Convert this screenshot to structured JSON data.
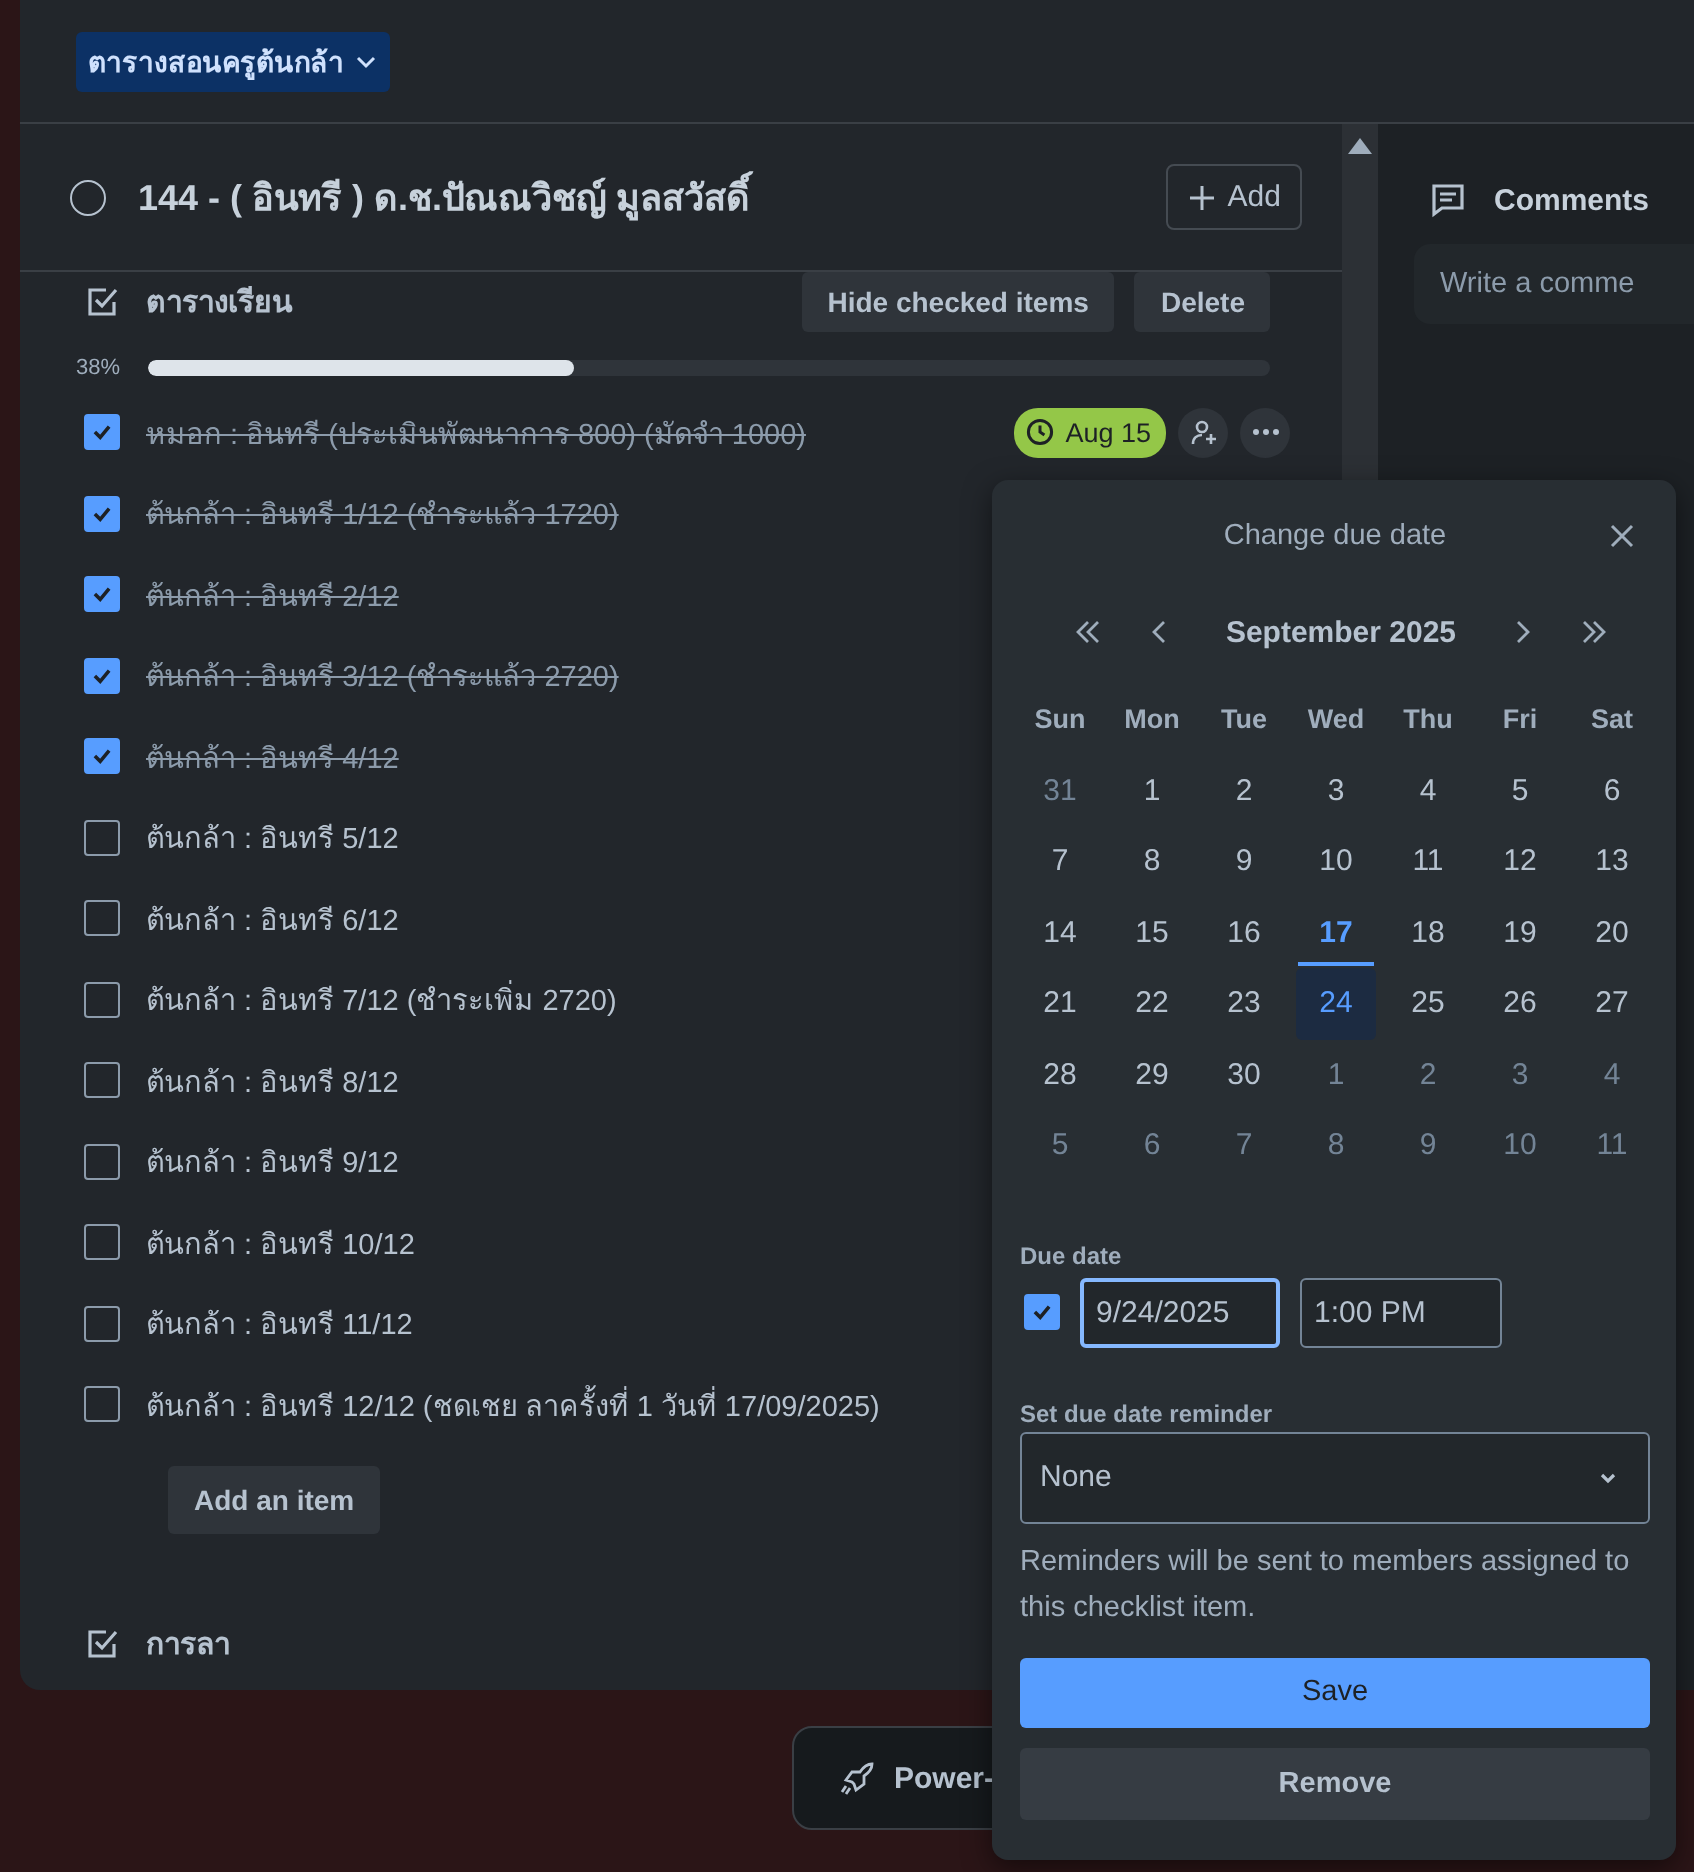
{
  "board_menu": {
    "label": "ตารางสอนครูต้นกล้า"
  },
  "card": {
    "title": "144 - ( อินทรี ) ด.ช.ปัณณวิชญ์ มูลสวัสดิ์",
    "completed": false,
    "add_button": "Add"
  },
  "checklists": [
    {
      "title": "ตารางเรียน",
      "hide_button": "Hide checked items",
      "delete_button": "Delete",
      "progress_label": "38%",
      "level": 0.38,
      "add_item_button": "Add an item",
      "items": [
        {
          "text": "หมอก : อินทรี (ประเมินพัฒนาการ 800) (มัดจำ 1000)",
          "checked": true,
          "due": "Aug 15"
        },
        {
          "text": "ต้นกล้า : อินทรี 1/12 (ชำระแล้ว 1720)",
          "checked": true
        },
        {
          "text": "ต้นกล้า : อินทรี 2/12",
          "checked": true
        },
        {
          "text": "ต้นกล้า : อินทรี 3/12 (ชำระแล้ว 2720)",
          "checked": true
        },
        {
          "text": "ต้นกล้า : อินทรี 4/12",
          "checked": true
        },
        {
          "text": "ต้นกล้า : อินทรี 5/12",
          "checked": false
        },
        {
          "text": "ต้นกล้า : อินทรี 6/12",
          "checked": false
        },
        {
          "text": "ต้นกล้า : อินทรี 7/12 (ชำระเพิ่ม 2720)",
          "checked": false
        },
        {
          "text": "ต้นกล้า : อินทรี 8/12",
          "checked": false
        },
        {
          "text": "ต้นกล้า : อินทรี 9/12",
          "checked": false
        },
        {
          "text": "ต้นกล้า : อินทรี 10/12",
          "checked": false
        },
        {
          "text": "ต้นกล้า : อินทรี 11/12",
          "checked": false
        },
        {
          "text": "ต้นกล้า : อินทรี 12/12 (ชดเชย ลาครั้งที่ 1 วันที่ 17/09/2025)",
          "checked": false
        }
      ]
    },
    {
      "title": "การลา"
    }
  ],
  "comments": {
    "title": "Comments",
    "placeholder": "Write a comme"
  },
  "power_ups_button": {
    "label": "Power-"
  },
  "due_date_popover": {
    "title": "Change due date",
    "month_label": "September 2025",
    "weekdays": [
      "Sun",
      "Mon",
      "Tue",
      "Wed",
      "Thu",
      "Fri",
      "Sat"
    ],
    "weeks": [
      [
        {
          "day": "31",
          "outside": true,
          "today": false,
          "selected": false
        },
        {
          "day": "1",
          "outside": false,
          "today": false,
          "selected": false
        },
        {
          "day": "2",
          "outside": false,
          "today": false,
          "selected": false
        },
        {
          "day": "3",
          "outside": false,
          "today": false,
          "selected": false
        },
        {
          "day": "4",
          "outside": false,
          "today": false,
          "selected": false
        },
        {
          "day": "5",
          "outside": false,
          "today": false,
          "selected": false
        },
        {
          "day": "6",
          "outside": false,
          "today": false,
          "selected": false
        }
      ],
      [
        {
          "day": "7",
          "outside": false,
          "today": false,
          "selected": false
        },
        {
          "day": "8",
          "outside": false,
          "today": false,
          "selected": false
        },
        {
          "day": "9",
          "outside": false,
          "today": false,
          "selected": false
        },
        {
          "day": "10",
          "outside": false,
          "today": false,
          "selected": false
        },
        {
          "day": "11",
          "outside": false,
          "today": false,
          "selected": false
        },
        {
          "day": "12",
          "outside": false,
          "today": false,
          "selected": false
        },
        {
          "day": "13",
          "outside": false,
          "today": false,
          "selected": false
        }
      ],
      [
        {
          "day": "14",
          "outside": false,
          "today": false,
          "selected": false
        },
        {
          "day": "15",
          "outside": false,
          "today": false,
          "selected": false
        },
        {
          "day": "16",
          "outside": false,
          "today": false,
          "selected": false
        },
        {
          "day": "17",
          "outside": false,
          "today": true,
          "selected": false
        },
        {
          "day": "18",
          "outside": false,
          "today": false,
          "selected": false
        },
        {
          "day": "19",
          "outside": false,
          "today": false,
          "selected": false
        },
        {
          "day": "20",
          "outside": false,
          "today": false,
          "selected": false
        }
      ],
      [
        {
          "day": "21",
          "outside": false,
          "today": false,
          "selected": false
        },
        {
          "day": "22",
          "outside": false,
          "today": false,
          "selected": false
        },
        {
          "day": "23",
          "outside": false,
          "today": false,
          "selected": false
        },
        {
          "day": "24",
          "outside": false,
          "today": false,
          "selected": true
        },
        {
          "day": "25",
          "outside": false,
          "today": false,
          "selected": false
        },
        {
          "day": "26",
          "outside": false,
          "today": false,
          "selected": false
        },
        {
          "day": "27",
          "outside": false,
          "today": false,
          "selected": false
        }
      ],
      [
        {
          "day": "28",
          "outside": false,
          "today": false,
          "selected": false
        },
        {
          "day": "29",
          "outside": false,
          "today": false,
          "selected": false
        },
        {
          "day": "30",
          "outside": false,
          "today": false,
          "selected": false
        },
        {
          "day": "1",
          "outside": true,
          "today": false,
          "selected": false
        },
        {
          "day": "2",
          "outside": true,
          "today": false,
          "selected": false
        },
        {
          "day": "3",
          "outside": true,
          "today": false,
          "selected": false
        },
        {
          "day": "4",
          "outside": true,
          "today": false,
          "selected": false
        }
      ],
      [
        {
          "day": "5",
          "outside": true,
          "today": false,
          "selected": false
        },
        {
          "day": "6",
          "outside": true,
          "today": false,
          "selected": false
        },
        {
          "day": "7",
          "outside": true,
          "today": false,
          "selected": false
        },
        {
          "day": "8",
          "outside": true,
          "today": false,
          "selected": false
        },
        {
          "day": "9",
          "outside": true,
          "today": false,
          "selected": false
        },
        {
          "day": "10",
          "outside": true,
          "today": false,
          "selected": false
        },
        {
          "day": "11",
          "outside": true,
          "today": false,
          "selected": false
        }
      ]
    ],
    "due_date": {
      "label": "Due date",
      "enabled": true,
      "date_value": "9/24/2025",
      "date_focused": true,
      "time_value": "1:00 PM"
    },
    "reminder": {
      "label": "Set due date reminder",
      "value": "None"
    },
    "help_text": "Reminders will be sent to members assigned to this checklist item.",
    "save_button": "Save",
    "remove_button": "Remove"
  }
}
